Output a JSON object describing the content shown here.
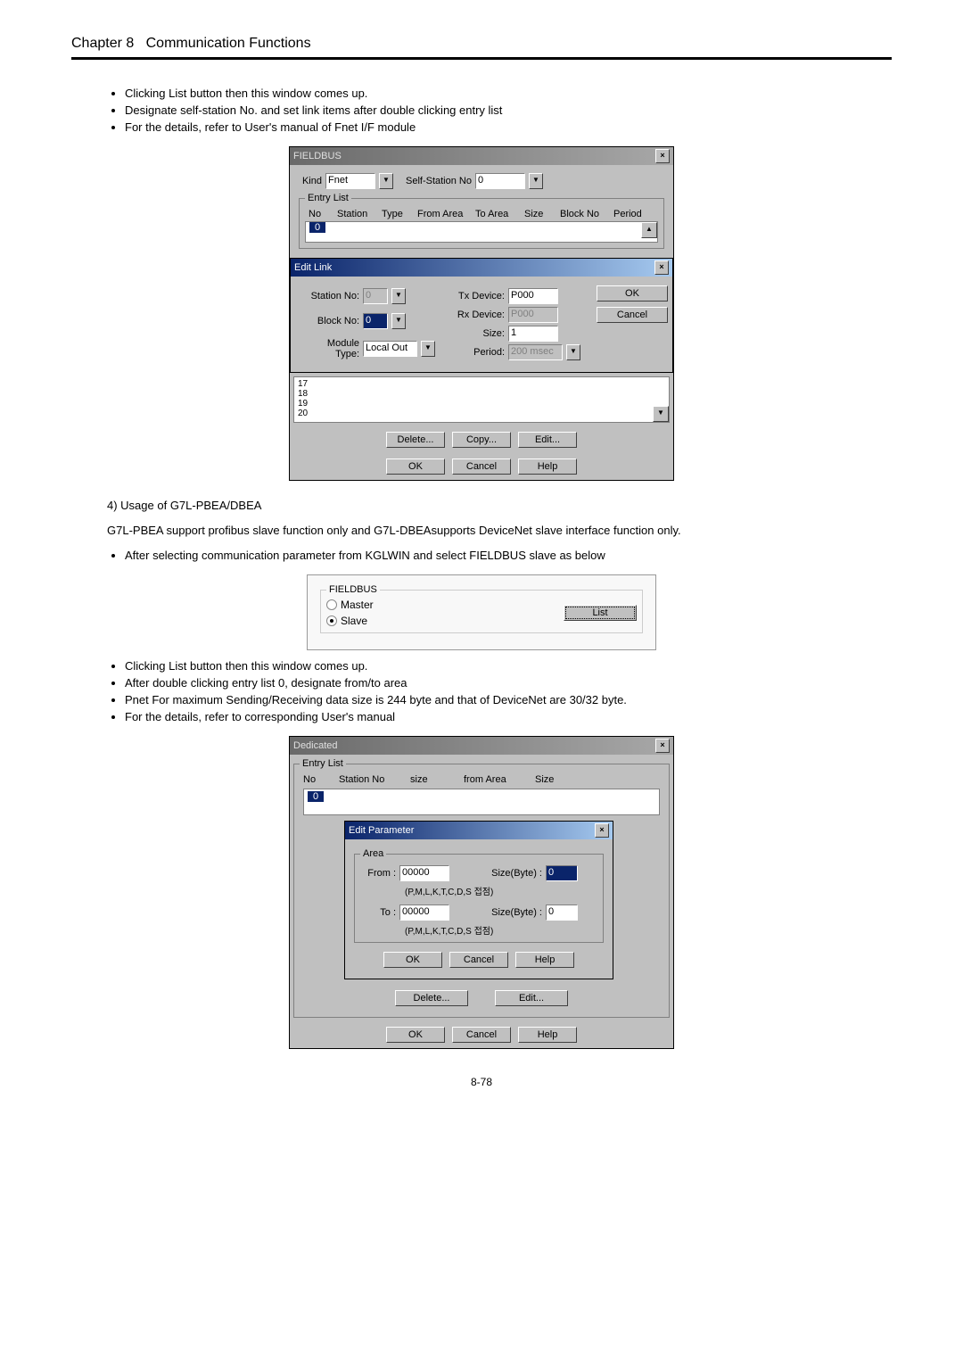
{
  "header": {
    "chapter": "Chapter 8",
    "title": "Communication Functions"
  },
  "bullets1": {
    "b1": "Clicking List button then this window comes up.",
    "b2": "Designate self-station No. and set link items after double clicking entry list",
    "b3": "For the details, refer to User's manual of Fnet I/F module"
  },
  "dlg1": {
    "title": "FIELDBUS",
    "kind_label": "Kind",
    "kind_value": "Fnet",
    "selfstation_label": "Self-Station No",
    "selfstation_value": "0",
    "entrylist_legend": "Entry List",
    "hdr_no": "No",
    "hdr_station": "Station",
    "hdr_type": "Type",
    "hdr_fromarea": "From Area",
    "hdr_toarea": "To Area",
    "hdr_size": "Size",
    "hdr_blockno": "Block No",
    "hdr_period": "Period",
    "entry_zero": "0",
    "editlink_title": "Edit Link",
    "station_no_label": "Station No:",
    "station_no_value": "0",
    "block_no_label": "Block No:",
    "block_no_value": "0",
    "module_type_label": "Module Type:",
    "module_type_value": "Local Out",
    "tx_label": "Tx Device:",
    "tx_value": "P000",
    "rx_label": "Rx Device:",
    "rx_value": "P000",
    "size_label": "Size:",
    "size_value": "1",
    "period_label": "Period:",
    "period_value": "200 msec",
    "ok": "OK",
    "cancel": "Cancel",
    "list_17": "17",
    "list_18": "18",
    "list_19": "19",
    "list_20": "20",
    "delete": "Delete...",
    "copy": "Copy...",
    "edit": "Edit...",
    "help": "Help"
  },
  "section4": {
    "label": "4) Usage of G7L-PBEA/DBEA",
    "para": "G7L-PBEA support profibus slave function only and G7L-DBEAsupports DeviceNet slave interface function only.",
    "b1": "After selecting communication parameter from KGLWIN and select FIELDBUS slave as below"
  },
  "dlg2": {
    "legend": "FIELDBUS",
    "master": "Master",
    "slave": "Slave",
    "list": "List"
  },
  "bullets3": {
    "b1": "Clicking List button then this window comes up.",
    "b2": "After double clicking entry list 0, designate from/to area",
    "b3": "Pnet For maximum Sending/Receiving data size is 244 byte and that of DeviceNet are 30/32 byte.",
    "b4": "For the details, refer to corresponding User's manual"
  },
  "dlg3": {
    "title": "Dedicated",
    "entrylist_legend": "Entry List",
    "hdr_no": "No",
    "hdr_stationno": "Station No",
    "hdr_size_l": "size",
    "hdr_fromarea": "from Area",
    "hdr_size_u": "Size",
    "entry_zero": "0",
    "editparam_title": "Edit Parameter",
    "area_legend": "Area",
    "from_label": "From :",
    "from_value": "00000",
    "from_hint": "(P,M,L,K,T,C,D,S 접점)",
    "sizebyte_label": "Size(Byte) :",
    "sizebyte_from": "0",
    "to_label": "To :",
    "to_value": "00000",
    "to_hint": "(P,M,L,K,T,C,D,S 접점)",
    "sizebyte_to": "0",
    "ok": "OK",
    "cancel": "Cancel",
    "help": "Help",
    "delete": "Delete...",
    "edit": "Edit..."
  },
  "page_number": "8-78"
}
